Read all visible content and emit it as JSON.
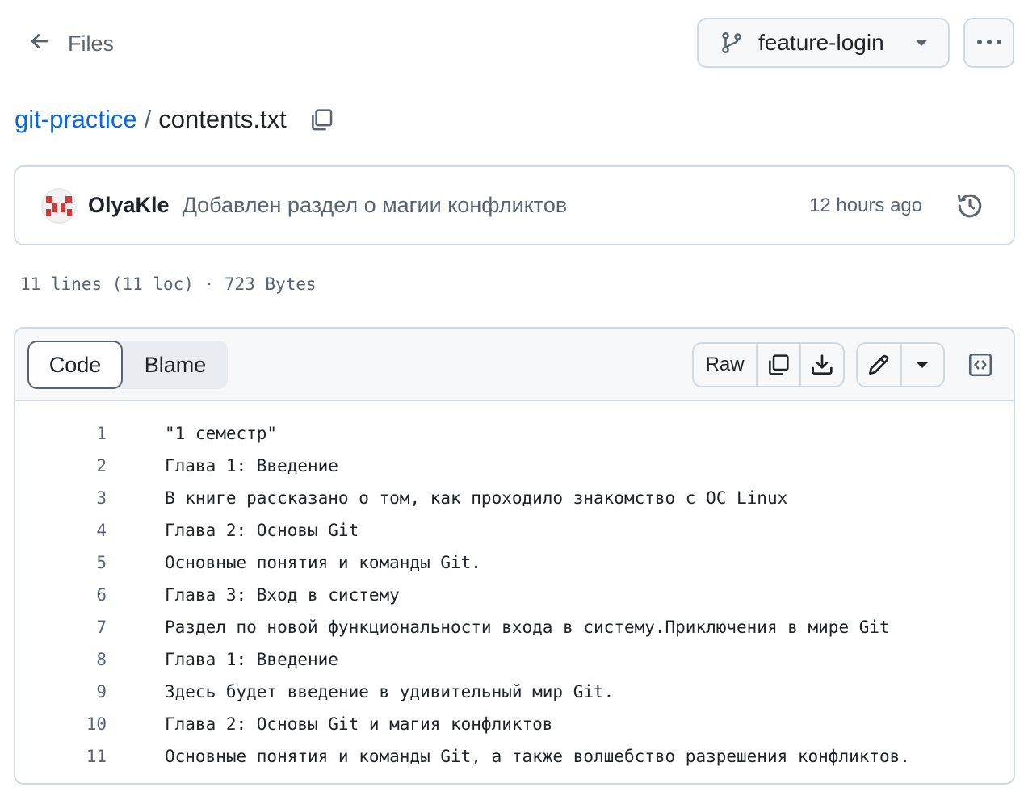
{
  "nav": {
    "back_label": "Files",
    "branch": "feature-login"
  },
  "breadcrumb": {
    "repo": "git-practice",
    "separator": "/",
    "file": "contents.txt"
  },
  "commit": {
    "author": "OlyaKle",
    "message": "Добавлен раздел о магии конфликтов",
    "time": "12 hours ago"
  },
  "file_meta": "11 lines (11 loc) · 723 Bytes",
  "tabs": {
    "code": "Code",
    "blame": "Blame"
  },
  "toolbar": {
    "raw": "Raw"
  },
  "icons": {
    "back": "arrow-left-icon",
    "branch": "git-branch-icon",
    "more": "kebab-horizontal-icon",
    "copy_path": "copy-icon",
    "avatar": "identicon",
    "history": "history-icon",
    "copy_raw": "copy-icon",
    "download": "download-icon",
    "edit": "pencil-icon",
    "symbols": "code-square-icon"
  },
  "colors": {
    "link": "#0969da",
    "muted": "#59636e",
    "border": "#d1d9e0",
    "avatar_red": "#d13a3a"
  },
  "lines": [
    {
      "n": "1",
      "text": "\"1 семестр\""
    },
    {
      "n": "2",
      "text": "Глава 1: Введение"
    },
    {
      "n": "3",
      "text": "В книге рассказано о том, как проходило знакомство с ОС Linux"
    },
    {
      "n": "4",
      "text": "Глава 2: Основы Git"
    },
    {
      "n": "5",
      "text": "Основные понятия и команды Git."
    },
    {
      "n": "6",
      "text": "Глава 3: Вход в систему"
    },
    {
      "n": "7",
      "text": "Раздел по новой функциональности входа в систему.Приключения в мире Git"
    },
    {
      "n": "8",
      "text": "Глава 1: Введение"
    },
    {
      "n": "9",
      "text": "Здесь будет введение в удивительный мир Git."
    },
    {
      "n": "10",
      "text": "Глава 2: Основы Git и магия конфликтов"
    },
    {
      "n": "11",
      "text": "Основные понятия и команды Git, а также волшебство разрешения конфликтов."
    }
  ]
}
